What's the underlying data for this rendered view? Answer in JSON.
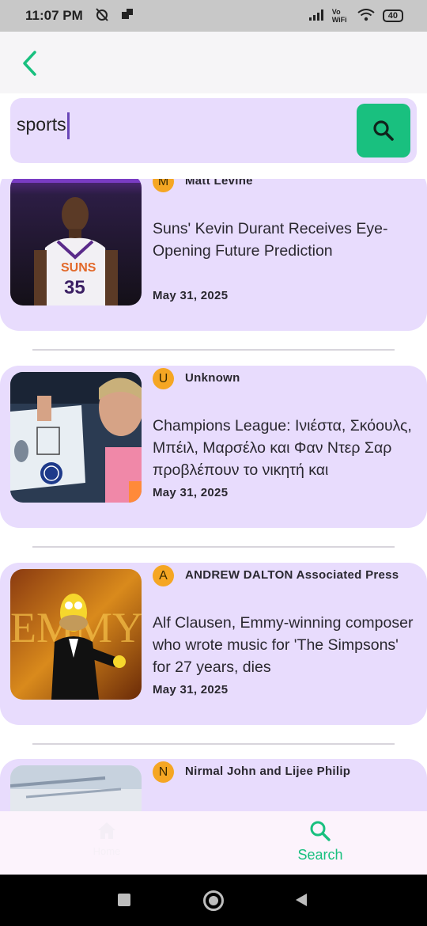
{
  "status_bar": {
    "time": "11:07 PM",
    "network": "Vo WiFi",
    "battery": "40"
  },
  "search": {
    "value": "sports",
    "button_icon": "search-icon"
  },
  "articles": [
    {
      "avatar_letter": "M",
      "author": "Matt Levine",
      "title": "Suns' Kevin Durant Receives Eye-Opening Future Prediction",
      "date": "May 31, 2025"
    },
    {
      "avatar_letter": "U",
      "author": "Unknown",
      "title": "Champions League: Ινιέστα, Σκόουλς, Μπέιλ, Μαρσέλο και Φαν Ντερ Σαρ προβλέπουν το νικητή και",
      "date": "May 31, 2025"
    },
    {
      "avatar_letter": "A",
      "author": "ANDREW DALTON Associated Press",
      "title": "Alf Clausen, Emmy-winning composer who wrote music for 'The Simpsons' for 27 years, dies",
      "date": "May 31, 2025"
    },
    {
      "avatar_letter": "N",
      "author": "Nirmal John and Lijee Philip",
      "title": "",
      "date": ""
    }
  ],
  "bottom_nav": {
    "home_label": "Home",
    "search_label": "Search"
  },
  "colors": {
    "accent": "#19c07f",
    "card": "#e8dcfd",
    "avatar": "#f5a623"
  }
}
